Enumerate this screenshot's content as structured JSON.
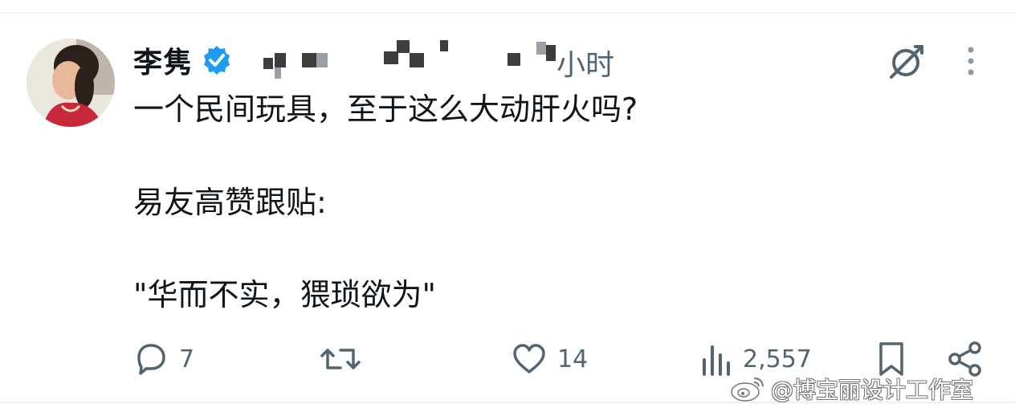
{
  "post": {
    "author_name": "李隽",
    "time_suffix": "小时",
    "lines": [
      "一个民间玩具，至于这么大动肝火吗?",
      "易友高赞跟贴:",
      "\"华而不实，猥琐欲为\""
    ]
  },
  "actions": {
    "reply_count": "7",
    "like_count": "14",
    "views_count": "2,557"
  },
  "watermark": {
    "text": "@博宝丽设计工作室"
  },
  "icons": {
    "verified": "verified-badge-icon",
    "grok": "grok-icon",
    "more": "more-vertical-icon",
    "reply": "reply-icon",
    "retweet": "retweet-icon",
    "like": "heart-icon",
    "views": "views-bar-icon",
    "bookmark": "bookmark-icon",
    "share": "share-icon",
    "weibo": "weibo-logo-icon"
  },
  "colors": {
    "verified_blue": "#1d9bf0",
    "text_primary": "#0f1419",
    "text_secondary": "#536471",
    "divider": "#eff1f3"
  }
}
